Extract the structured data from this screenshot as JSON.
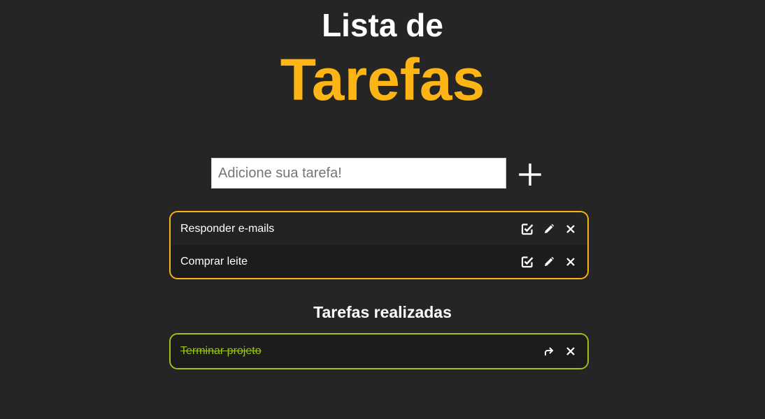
{
  "header": {
    "title_line1": "Lista de",
    "title_line2": "Tarefas"
  },
  "new_task": {
    "placeholder": "Adicione sua tarefa!",
    "value": "",
    "add_icon": "plus-icon"
  },
  "pending_tasks": [
    {
      "label": "Responder e-mails",
      "icons": [
        "check-square-icon",
        "pencil-icon",
        "close-icon"
      ]
    },
    {
      "label": "Comprar leite",
      "icons": [
        "check-square-icon",
        "pencil-icon",
        "close-icon"
      ]
    }
  ],
  "done_section": {
    "title": "Tarefas realizadas",
    "tasks": [
      {
        "label": "Terminar projeto",
        "icons": [
          "undo-arrow-icon",
          "close-icon"
        ]
      }
    ]
  },
  "colors": {
    "background": "#252525",
    "accent": "#fdb515",
    "done": "#9cc21c"
  }
}
